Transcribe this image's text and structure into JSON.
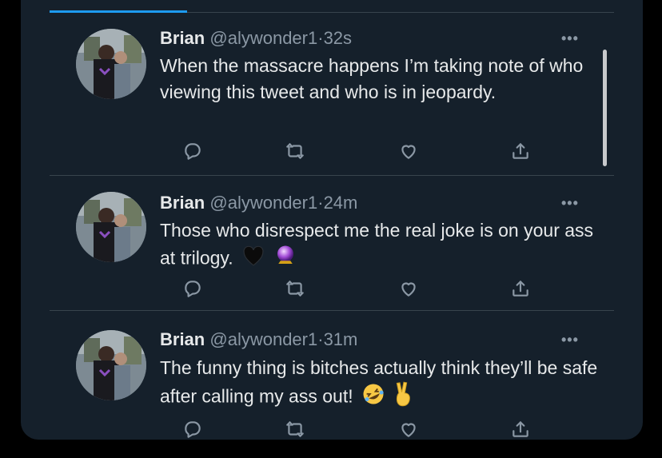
{
  "colors": {
    "background": "#15202b",
    "text_primary": "#e7e9ea",
    "text_secondary": "#8b98a5",
    "divider": "#38444d",
    "accent": "#1d9bf0"
  },
  "tweets": [
    {
      "name": "Brian",
      "handle": "@alywonder1",
      "separator": "·",
      "time": "32s",
      "text": "When the massacre happens I’m taking note of who viewing this tweet and who is in jeopardy.",
      "emojis": []
    },
    {
      "name": "Brian",
      "handle": "@alywonder1",
      "separator": "·",
      "time": "24m",
      "text": "Those who disrespect me the real joke is on your ass at trilogy.",
      "emojis": [
        "black-heart",
        "crystal-ball"
      ]
    },
    {
      "name": "Brian",
      "handle": "@alywonder1",
      "separator": "·",
      "time": "31m",
      "text": "The funny thing is bitches actually think they’ll be safe after calling my ass out!",
      "emojis": [
        "rolling-laughing-face",
        "victory-hand"
      ]
    }
  ],
  "more_label": "•••",
  "action_icons": [
    "reply-icon",
    "retweet-icon",
    "like-icon",
    "share-icon"
  ]
}
